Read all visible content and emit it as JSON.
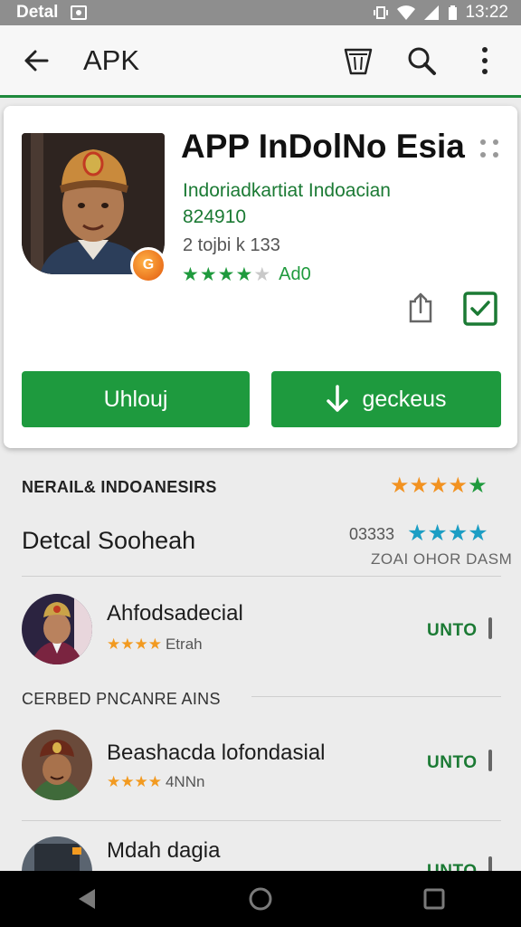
{
  "status_bar": {
    "carrier": "Detal",
    "time": "13:22"
  },
  "toolbar": {
    "title": "APK"
  },
  "app": {
    "title": "APP InDolNo Esia",
    "developer": "Indoriadkartiat Indoacian",
    "version": "824910",
    "size": "2 tojbi k 133",
    "rating_label": "Ad0",
    "rating_stars": 4,
    "badge_text": "G"
  },
  "buttons": {
    "uninstall": "Uhlouj",
    "download": "geckeus"
  },
  "section1": {
    "header": "NERAIL& INDOANESIRS"
  },
  "detail": {
    "title": "Detcal Sooheah",
    "count": "03333",
    "subtitle": "ZOAI OHOR DASM"
  },
  "related": [
    {
      "name": "Ahfodsadecial",
      "meta": "Etrah",
      "action": "UNTO"
    }
  ],
  "section2": {
    "header": "CERBED PNCANRE AINS"
  },
  "similar": [
    {
      "name": "Beashacda lofondasial",
      "meta": "4NNn",
      "action": "UNTO"
    },
    {
      "name": "Mdah dagia",
      "meta": "",
      "action": "UNTO"
    }
  ],
  "colors": {
    "accent": "#1e9a3e",
    "star_orange": "#f29220",
    "star_blue": "#1c9ec4"
  }
}
